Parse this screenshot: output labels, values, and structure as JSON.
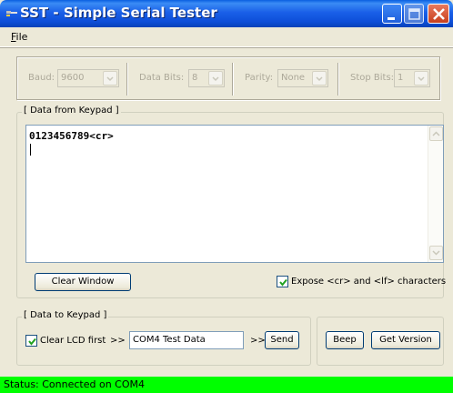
{
  "window": {
    "title": "SST - Simple Serial Tester"
  },
  "menu": {
    "file_label": "File",
    "file_mnemonic": "F",
    "file_rest": "ile"
  },
  "settings": {
    "baud_label": "Baud:",
    "baud_value": "9600",
    "databits_label": "Data Bits:",
    "databits_value": "8",
    "parity_label": "Parity:",
    "parity_value": "None",
    "stopbits_label": "Stop Bits:",
    "stopbits_value": "1"
  },
  "data_from_keypad": {
    "title": "[ Data from Keypad ]",
    "text": "0123456789<cr>",
    "clear_button": "Clear Window",
    "expose_checked": true,
    "expose_label": "Expose <cr> and <lf> characters"
  },
  "data_to_keypad": {
    "title": "[ Data to Keypad ]",
    "clear_lcd_checked": true,
    "clear_lcd_label": "Clear LCD first",
    "arrow_1": ">>",
    "input_value": "COM4 Test Data",
    "arrow_2": ">>",
    "send_button": "Send",
    "beep_button": "Beep",
    "getversion_button": "Get Version"
  },
  "status": {
    "text": "Status: Connected on COM4",
    "color": "#00ff00"
  },
  "icons": {
    "app": "app-icon",
    "minimize": "minimize-icon",
    "maximize": "maximize-icon",
    "close": "close-icon"
  }
}
